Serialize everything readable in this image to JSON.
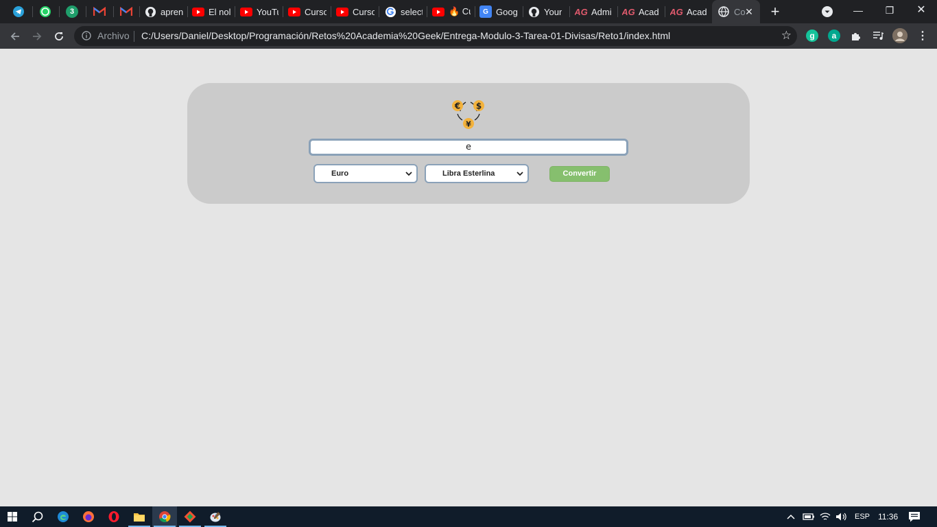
{
  "browser": {
    "tabs": [
      {
        "title": "",
        "icon": "telegram-icon",
        "color": "#2aa1da"
      },
      {
        "title": "",
        "icon": "whatsapp-icon",
        "color": "#25d366"
      },
      {
        "title": "",
        "icon": "badge-3-icon",
        "color": "#1f9e6b",
        "badge": "3"
      },
      {
        "title": "",
        "icon": "gmail-icon",
        "color": "#ea4335"
      },
      {
        "title": "",
        "icon": "gmail-icon",
        "color": "#ea4335"
      },
      {
        "title": "apren",
        "icon": "github-icon",
        "color": "#e8eaed"
      },
      {
        "title": "El nol",
        "icon": "youtube-icon",
        "color": "#ff0000"
      },
      {
        "title": "YouTu",
        "icon": "youtube-icon",
        "color": "#ff0000"
      },
      {
        "title": "Curso",
        "icon": "youtube-icon",
        "color": "#ff0000"
      },
      {
        "title": "Curso",
        "icon": "youtube-icon",
        "color": "#ff0000"
      },
      {
        "title": "select",
        "icon": "google-icon",
        "color": "#4285f4"
      },
      {
        "title": "🔥 Cu",
        "icon": "youtube-icon",
        "color": "#ff0000"
      },
      {
        "title": "Goog",
        "icon": "google-translate-icon",
        "color": "#4285f4"
      },
      {
        "title": "Your",
        "icon": "github-icon",
        "color": "#e8eaed"
      },
      {
        "title": "Admi",
        "icon": "ag-logo-icon",
        "color": "#e05a6d",
        "badge": "AG"
      },
      {
        "title": "Acad",
        "icon": "ag-logo-icon",
        "color": "#e05a6d",
        "badge": "AG"
      },
      {
        "title": "Acad",
        "icon": "ag-logo-icon",
        "color": "#e05a6d",
        "badge": "AG"
      },
      {
        "title": "Co",
        "icon": "globe-icon",
        "color": "#e8eaed",
        "active": true
      }
    ],
    "address": {
      "scheme_label": "Archivo",
      "url": "C:/Users/Daniel/Desktop/Programación/Retos%20Academia%20Geek/Entrega-Modulo-3-Tarea-01-Divisas/Reto1/index.html"
    },
    "extensions": [
      {
        "icon": "grammarly-icon",
        "letter": "g",
        "color": "#15c39a"
      },
      {
        "icon": "a-extension-icon",
        "letter": "a",
        "color": "#00a88f"
      }
    ]
  },
  "converter": {
    "amount_value": "e",
    "from_currency": "Euro",
    "to_currency": "Libra Esterlina",
    "convert_label": "Convertir",
    "logo_symbols": [
      "€",
      "$",
      "¥"
    ],
    "accent_color": "#f3b23c",
    "button_color": "#86bf6e"
  },
  "taskbar": {
    "apps": [
      {
        "icon": "search-icon"
      },
      {
        "icon": "edge-icon"
      },
      {
        "icon": "firefox-icon"
      },
      {
        "icon": "opera-icon"
      },
      {
        "icon": "file-explorer-icon"
      },
      {
        "icon": "chrome-icon"
      },
      {
        "icon": "git-icon"
      },
      {
        "icon": "paint-icon"
      }
    ],
    "language": "ESP",
    "time": "11:36"
  }
}
